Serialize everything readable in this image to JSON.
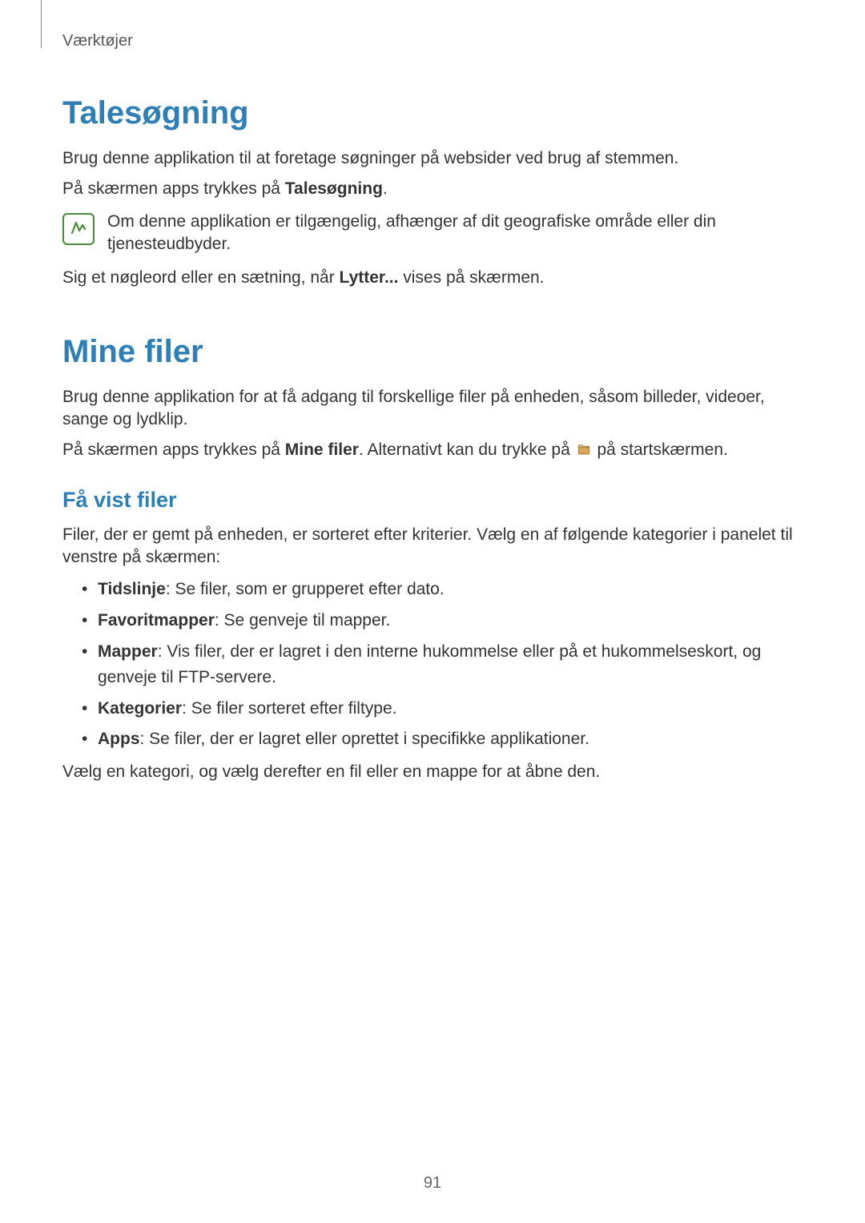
{
  "breadcrumb": "Værktøjer",
  "section1": {
    "title": "Talesøgning",
    "p1": "Brug denne applikation til at foretage søgninger på websider ved brug af stemmen.",
    "p2_pre": "På skærmen apps trykkes på ",
    "p2_bold": "Talesøgning",
    "p2_post": ".",
    "note": "Om denne applikation er tilgængelig, afhænger af dit geografiske område eller din tjenesteudbyder.",
    "p3_pre": "Sig et nøgleord eller en sætning, når ",
    "p3_bold": "Lytter...",
    "p3_post": " vises på skærmen."
  },
  "section2": {
    "title": "Mine filer",
    "p1": "Brug denne applikation for at få adgang til forskellige filer på enheden, såsom billeder, videoer, sange og lydklip.",
    "p2_pre": "På skærmen apps trykkes på ",
    "p2_bold": "Mine filer",
    "p2_mid": ". Alternativt kan du trykke på ",
    "p2_post": " på startskærmen.",
    "sub": {
      "title": "Få vist filer",
      "intro": "Filer, der er gemt på enheden, er sorteret efter kriterier. Vælg en af følgende kategorier i panelet til venstre på skærmen:",
      "items": [
        {
          "label": "Tidslinje",
          "text": ": Se filer, som er grupperet efter dato."
        },
        {
          "label": "Favoritmapper",
          "text": ": Se genveje til mapper."
        },
        {
          "label": "Mapper",
          "text": ": Vis filer, der er lagret i den interne hukommelse eller på et hukommelseskort, og genveje til FTP-servere."
        },
        {
          "label": "Kategorier",
          "text": ": Se filer sorteret efter filtype."
        },
        {
          "label": "Apps",
          "text": ": Se filer, der er lagret eller oprettet i specifikke applikationer."
        }
      ],
      "outro": "Vælg en kategori, og vælg derefter en fil eller en mappe for at åbne den."
    }
  },
  "page_number": "91"
}
